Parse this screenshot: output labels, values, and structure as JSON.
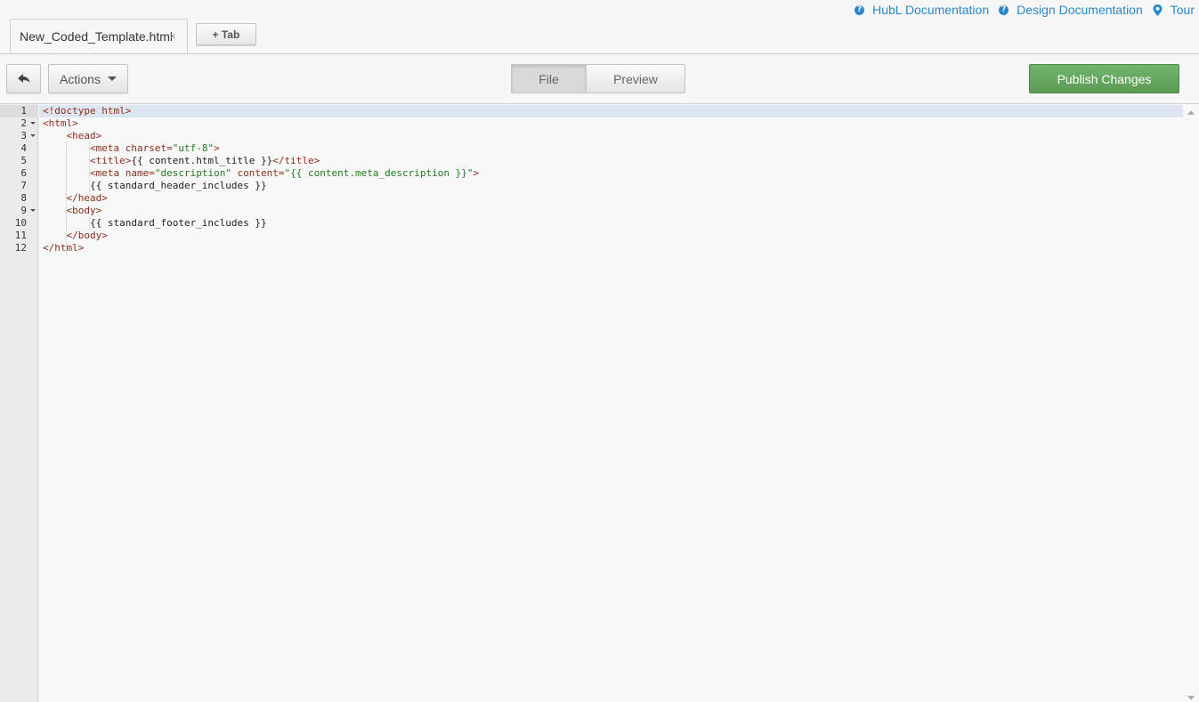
{
  "help_links": [
    {
      "label": "HubL Documentation",
      "icon": "question-circle-icon"
    },
    {
      "label": "Design Documentation",
      "icon": "question-circle-icon"
    },
    {
      "label": "Tour",
      "icon": "map-pin-icon"
    }
  ],
  "tabs": {
    "active_tab": {
      "label": "New_Coded_Template.html",
      "close": "×"
    },
    "add_tab_label": "+ Tab"
  },
  "toolbar": {
    "back_icon": "undo-arrow-icon",
    "actions_label": "Actions",
    "view_toggle": {
      "file_label": "File",
      "preview_label": "Preview",
      "selected": "File"
    },
    "publish_label": "Publish Changes"
  },
  "colors": {
    "link": "#2b88c8",
    "publish": "#5fa05a",
    "tag": "#8b2d1b",
    "string": "#1f7a1f",
    "active_line": "#dde6f0"
  },
  "editor": {
    "active_line": 1,
    "lines": [
      {
        "n": "1",
        "fold": false,
        "text": "<!doctype html>"
      },
      {
        "n": "2",
        "fold": true,
        "text": "<html>"
      },
      {
        "n": "3",
        "fold": true,
        "text": "    <head>"
      },
      {
        "n": "4",
        "fold": false,
        "text": "        <meta charset=\"utf-8\">"
      },
      {
        "n": "5",
        "fold": false,
        "text": "        <title>{{ content.html_title }}</title>"
      },
      {
        "n": "6",
        "fold": false,
        "text": "        <meta name=\"description\" content=\"{{ content.meta_description }}\">"
      },
      {
        "n": "7",
        "fold": false,
        "text": "        {{ standard_header_includes }}"
      },
      {
        "n": "8",
        "fold": false,
        "text": "    </head>"
      },
      {
        "n": "9",
        "fold": true,
        "text": "    <body>"
      },
      {
        "n": "10",
        "fold": false,
        "text": "        {{ standard_footer_includes }}"
      },
      {
        "n": "11",
        "fold": false,
        "text": "    </body>"
      },
      {
        "n": "12",
        "fold": false,
        "text": "</html>"
      }
    ]
  }
}
